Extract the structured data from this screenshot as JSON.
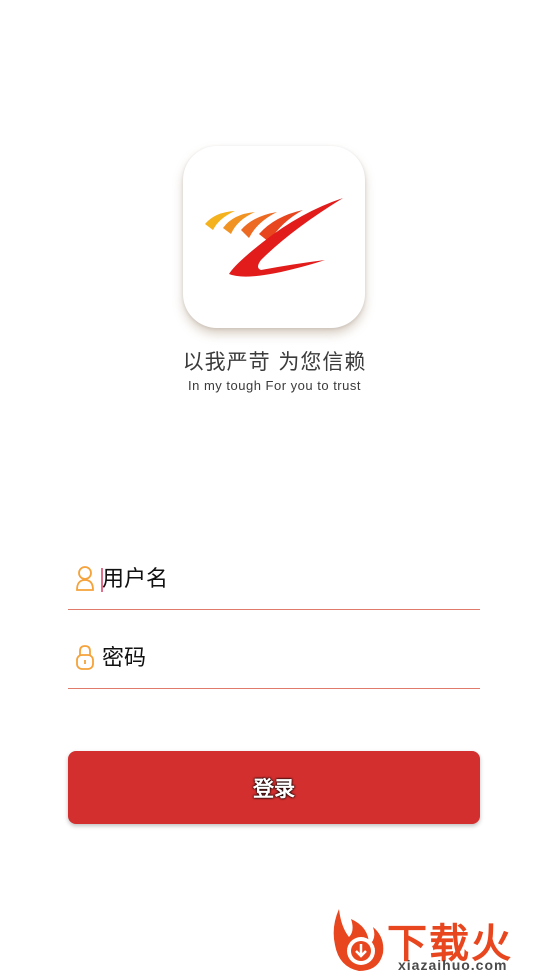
{
  "brand": {
    "slogan_cn": "以我严苛 为您信赖",
    "slogan_en": "In my tough For you to trust"
  },
  "form": {
    "username_placeholder": "用户名",
    "password_placeholder": "密码",
    "login_label": "登录",
    "accent_color": "#d32f2f",
    "icon_color": "#f5a23a"
  },
  "watermark": {
    "brand": "下载火",
    "url": "xiazaihuo.com"
  }
}
